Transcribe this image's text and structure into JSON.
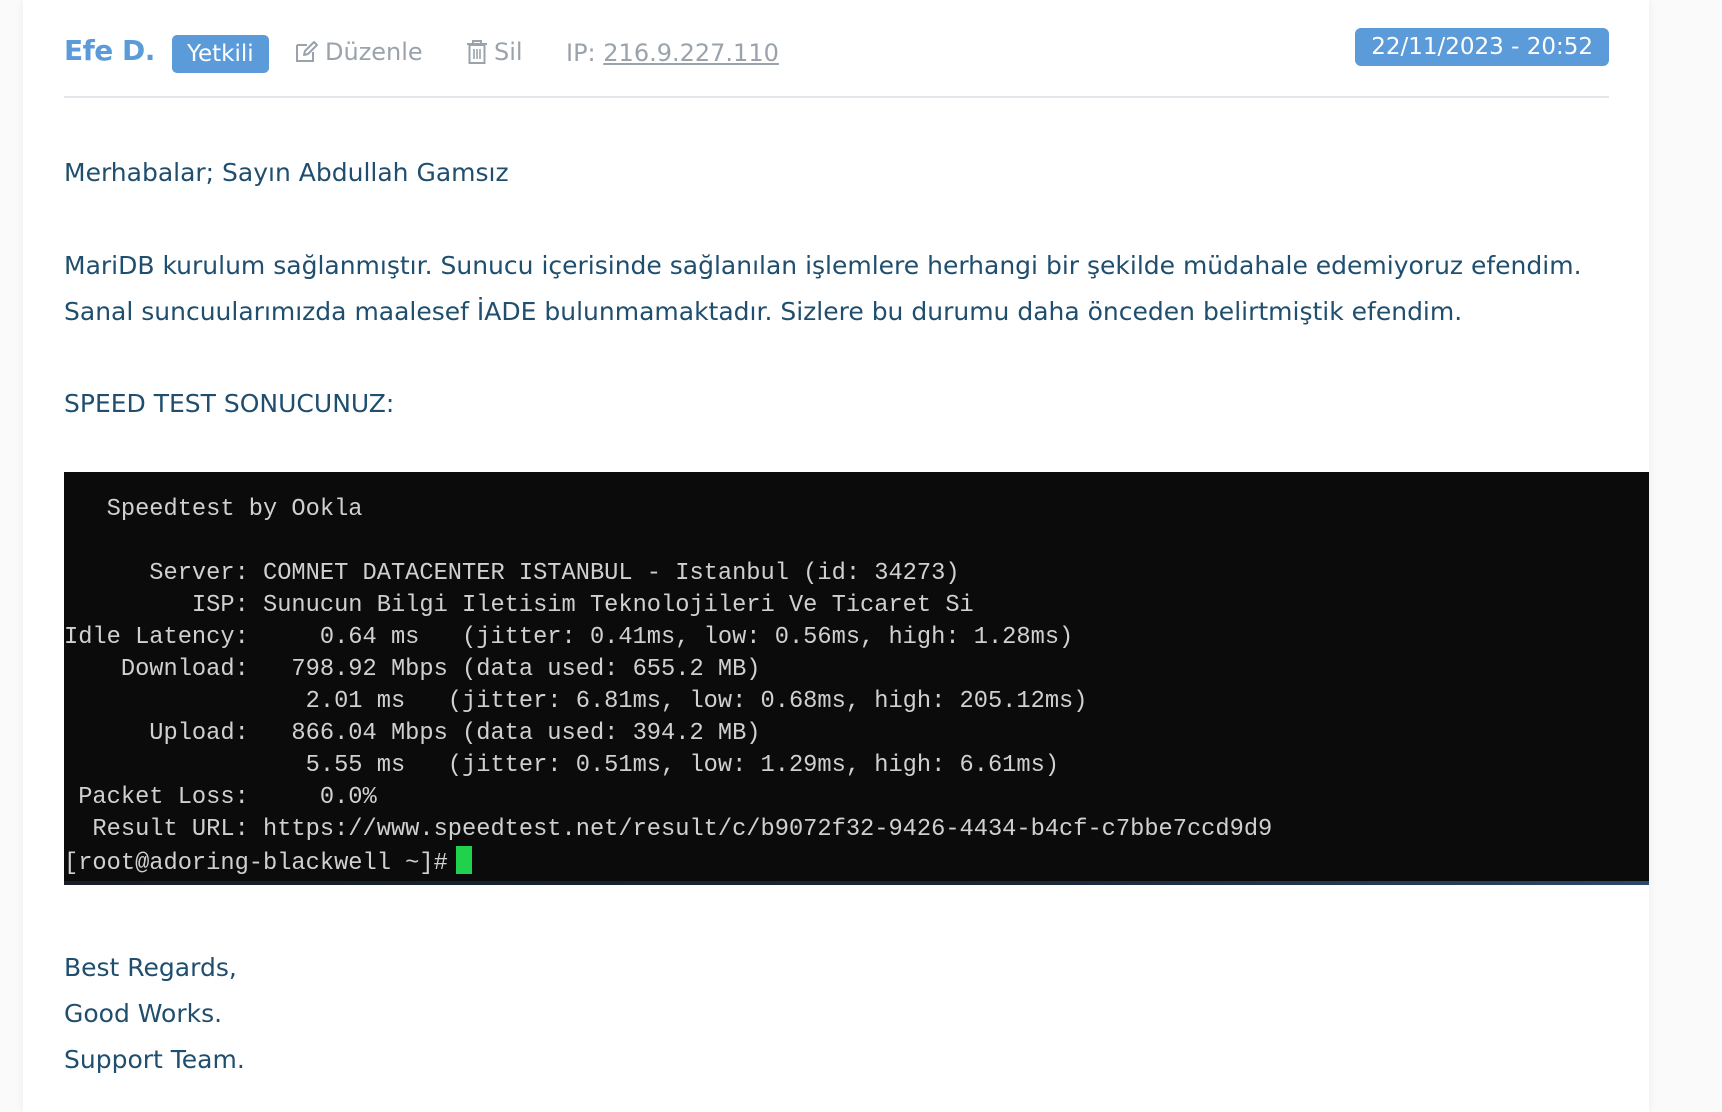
{
  "post": {
    "author": "Efe D.",
    "role": "Yetkili",
    "edit_label": "Düzenle",
    "delete_label": "Sil",
    "ip_prefix": "IP:",
    "ip": "216.9.227.110",
    "datetime": "22/11/2023 - 20:52"
  },
  "message": {
    "greeting": "Merhabalar; Sayın Abdullah Gamsız",
    "line1": "MariDB kurulum sağlanmıştır. Sunucu içerisinde sağlanılan işlemlere herhangi bir şekilde müdahale edemiyoruz efendim.",
    "line2": "Sanal suncuularımızda maalesef İADE bulunmamaktadır. Sizlere bu durumu daha önceden belirtmiştik efendim.",
    "speed_heading": "SPEED TEST SONUCUNUZ:"
  },
  "terminal": {
    "lines": [
      "   Speedtest by Ookla",
      "",
      "      Server: COMNET DATACENTER ISTANBUL - Istanbul (id: 34273)",
      "         ISP: Sunucun Bilgi Iletisim Teknolojileri Ve Ticaret Si",
      "Idle Latency:     0.64 ms   (jitter: 0.41ms, low: 0.56ms, high: 1.28ms)",
      "    Download:   798.92 Mbps (data used: 655.2 MB)",
      "                 2.01 ms   (jitter: 6.81ms, low: 0.68ms, high: 205.12ms)",
      "      Upload:   866.04 Mbps (data used: 394.2 MB)",
      "                 5.55 ms   (jitter: 0.51ms, low: 1.29ms, high: 6.61ms)",
      " Packet Loss:     0.0%",
      "  Result URL: https://www.speedtest.net/result/c/b9072f32-9426-4434-b4cf-c7bbe7ccd9d9"
    ],
    "prompt": "[root@adoring-blackwell ~]#"
  },
  "signature": {
    "line1": "Best Regards,",
    "line2": "Good Works.",
    "line3": "Support Team."
  },
  "colors": {
    "accent": "#5b9bd9",
    "text": "#1f4e6e",
    "muted": "#9aa3ab",
    "cursor": "#1fd14b"
  }
}
